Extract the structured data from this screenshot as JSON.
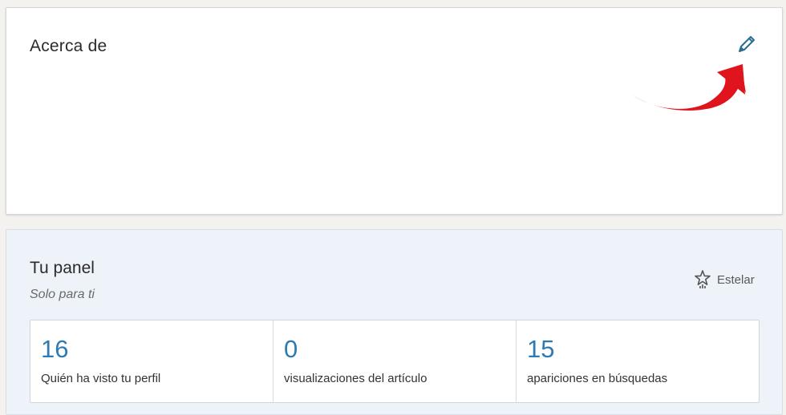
{
  "about": {
    "title": "Acerca de"
  },
  "dashboard": {
    "title": "Tu panel",
    "subtitle": "Solo para ti",
    "star_label": "Estelar",
    "stats": [
      {
        "value": "16",
        "label": "Quién ha visto tu perfil"
      },
      {
        "value": "0",
        "label": "visualizaciones del artículo"
      },
      {
        "value": "15",
        "label": "apariciones en búsquedas"
      }
    ]
  },
  "colors": {
    "accent": "#2e7bb4",
    "annotation": "#e0141c"
  },
  "icons": [
    "pencil-icon",
    "star-icon",
    "red-annotation-arrow"
  ]
}
